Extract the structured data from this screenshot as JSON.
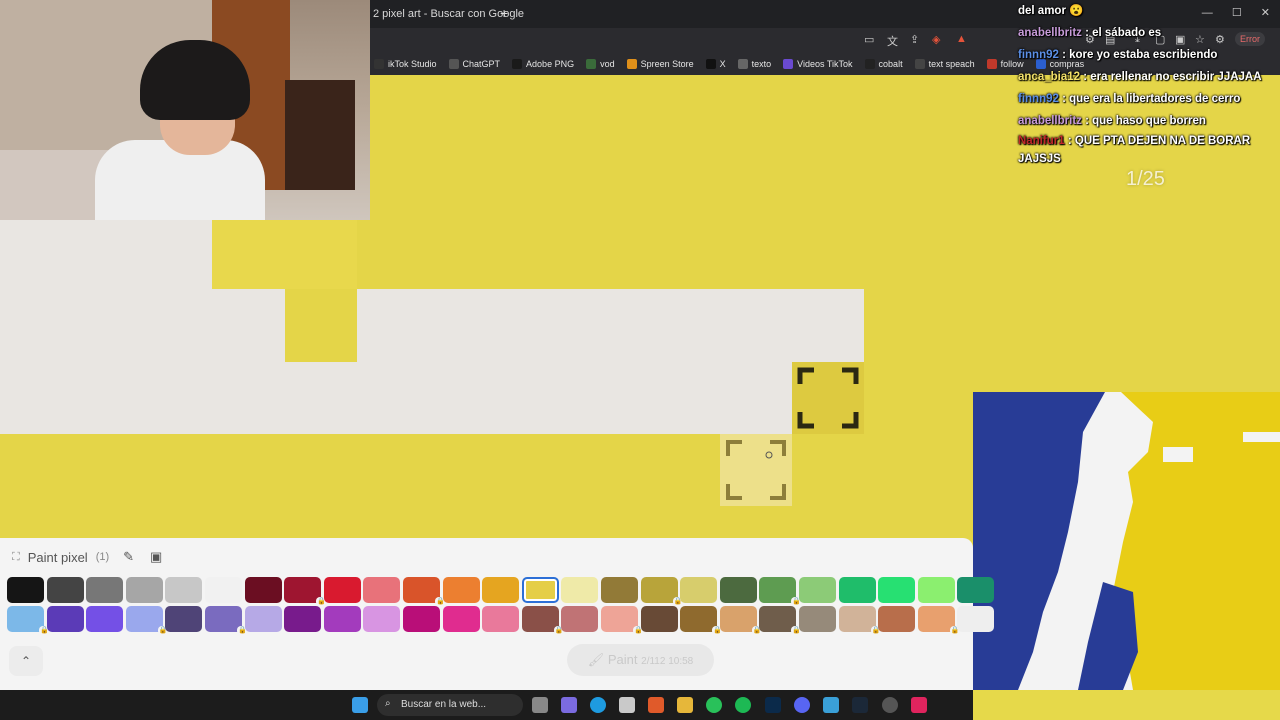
{
  "browser": {
    "tab_title": "2 pixel art - Buscar con Google",
    "new_tab": "+",
    "window_controls": "— ☐ ✕",
    "error_label": "Error",
    "bookmarks": [
      {
        "label": "ikTok Studio",
        "color": "#333333"
      },
      {
        "label": "ChatGPT",
        "color": "#555555"
      },
      {
        "label": "Adobe PNG",
        "color": "#1a1a1a"
      },
      {
        "label": "vod",
        "color": "#3a6b3a"
      },
      {
        "label": "Spreen Store",
        "color": "#e0901a"
      },
      {
        "label": "X",
        "color": "#111111"
      },
      {
        "label": "texto",
        "color": "#666666"
      },
      {
        "label": "Videos TikTok",
        "color": "#6a4ad0"
      },
      {
        "label": "cobalt",
        "color": "#222222"
      },
      {
        "label": "text speach",
        "color": "#444444"
      },
      {
        "label": "follow",
        "color": "#c0392b"
      },
      {
        "label": "compras",
        "color": "#2b5fd0"
      }
    ]
  },
  "chat": {
    "messages": [
      {
        "user": "",
        "text": "del amor 😮",
        "user_class": ""
      },
      {
        "user": "anabellbritz",
        "text": " : el sábado es",
        "user_class": "u-purple"
      },
      {
        "user": "finnn92",
        "text": " : kore yo estaba escribiendo",
        "user_class": "u-blue"
      },
      {
        "user": "anca_bia12",
        "text": " : era rellenar no escribir JJAJAA",
        "user_class": "u-yellow"
      },
      {
        "user": "finnn92",
        "text": " : que era la libertadores de cerro",
        "user_class": "u-blue"
      },
      {
        "user": "anabellbritz",
        "text": " : que haso que borren",
        "user_class": "u-purple"
      },
      {
        "user": "Nanifur1",
        "text": " : QUE PTA DEJEN NA DE BORAR JAJSJS",
        "user_class": "u-red"
      }
    ],
    "counter": "1/25"
  },
  "panel": {
    "title": "Paint pixel",
    "count": "(1)",
    "edit_icon": "✎",
    "save_icon": "▣",
    "expand_icon": "⛶",
    "collapse_icon": "⌃",
    "paint_label": "Paint",
    "paint_count": "2/112 10:58",
    "selected_color": "#e5ce47",
    "palette_row1": [
      "#151515",
      "#444444",
      "#777777",
      "#a6a6a6",
      "#c7c7c7",
      "#f1f1f1",
      "#6b0e22",
      "#9e1530",
      "#d91a2f",
      "#e8727a",
      "#d9542a",
      "#ec7f30",
      "#e5a520",
      "#e5ce47",
      "#efeaa8",
      "#927a37",
      "#b8a43a",
      "#d7cd6c",
      "#4c6a3f",
      "#5e9c51",
      "#8ccb77",
      "#1fbd6a",
      "#27e072",
      "#8bef6f",
      "#1a8f6a"
    ],
    "palette_row2": [
      "#7cb8e8",
      "#5b3bb7",
      "#7450e6",
      "#9aa8ed",
      "#4f4477",
      "#7a6bbf",
      "#b6a9e6",
      "#781b8c",
      "#a33bbd",
      "#d895e2",
      "#b90e78",
      "#e02c8f",
      "#e9799b",
      "#8a5048",
      "#c07375",
      "#eea497",
      "#684a36",
      "#8f6a2e",
      "#d9a26b",
      "#6f5d4b",
      "#968a7a",
      "#d1b399",
      "#b86e4b",
      "#e8a06e",
      "#eeeeee"
    ],
    "locked_row1": [
      7,
      10,
      16,
      19
    ],
    "locked_row2": [
      0,
      3,
      5,
      13,
      15,
      17,
      18,
      19,
      21,
      23
    ]
  },
  "taskbar": {
    "search_placeholder": "Buscar en la web..."
  }
}
